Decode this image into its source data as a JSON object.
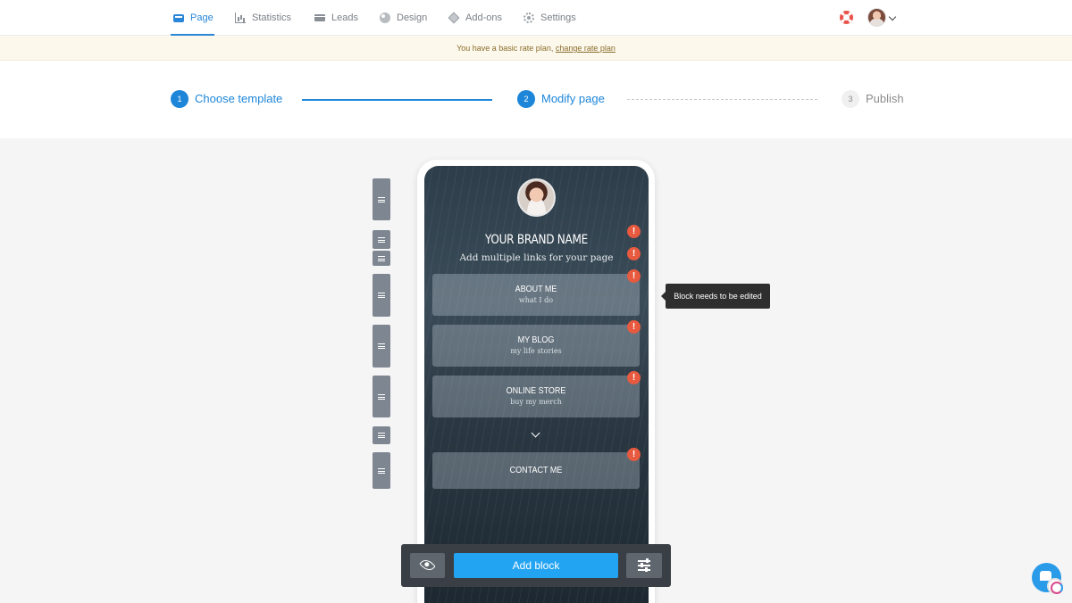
{
  "nav": {
    "items": [
      {
        "label": "Page",
        "icon": "page-icon",
        "active": true
      },
      {
        "label": "Statistics",
        "icon": "statistics-icon"
      },
      {
        "label": "Leads",
        "icon": "leads-icon"
      },
      {
        "label": "Design",
        "icon": "design-icon"
      },
      {
        "label": "Add-ons",
        "icon": "addons-icon"
      },
      {
        "label": "Settings",
        "icon": "settings-icon"
      }
    ],
    "help_icon": "lifebuoy-icon",
    "account_icon": "avatar"
  },
  "banner": {
    "text": "You have a basic rate plan,",
    "link": "change rate plan"
  },
  "stepper": {
    "steps": [
      {
        "number": "1",
        "label": "Choose template",
        "state": "done"
      },
      {
        "number": "2",
        "label": "Modify page",
        "state": "active"
      },
      {
        "number": "3",
        "label": "Publish",
        "state": "pending"
      }
    ]
  },
  "preview": {
    "brand_name": "YOUR BRAND NAME",
    "subtitle": "Add multiple links for your page",
    "links": [
      {
        "title": "ABOUT ME",
        "subtitle": "what I do"
      },
      {
        "title": "MY BLOG",
        "subtitle": "my life stories"
      },
      {
        "title": "ONLINE STORE",
        "subtitle": "buy my merch"
      },
      {
        "title": "CONTACT ME",
        "subtitle": ""
      }
    ],
    "alert_glyph": "!"
  },
  "tooltip": {
    "text": "Block needs to be edited"
  },
  "toolbar": {
    "add_block_label": "Add block",
    "preview_icon": "eye-icon",
    "settings_icon": "sliders-icon"
  },
  "colors": {
    "accent": "#1d86d9",
    "add_button": "#23a4f2",
    "alert": "#e85a3f",
    "banner_bg": "#fcf8ec"
  }
}
